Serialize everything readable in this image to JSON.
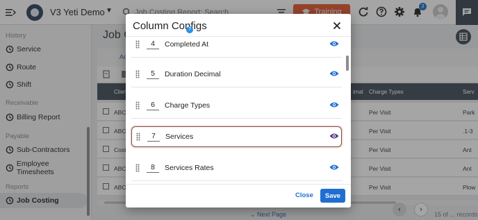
{
  "topbar": {
    "app_title": "V3 Yeti Demo",
    "search_placeholder": "Job Costing Report: Search",
    "training_label": "Training",
    "notification_count": "3"
  },
  "sidebar": {
    "sections": [
      {
        "title": "History",
        "items": [
          {
            "label": "Service"
          },
          {
            "label": "Route"
          },
          {
            "label": "Shift"
          }
        ]
      },
      {
        "title": "Receivable",
        "items": [
          {
            "label": "Billing Report"
          }
        ]
      },
      {
        "title": "Payable",
        "items": [
          {
            "label": "Sub-Contractors"
          },
          {
            "label": "Employee Timesheets"
          }
        ]
      },
      {
        "title": "Reports",
        "items": [
          {
            "label": "Job Costing",
            "active": true
          }
        ]
      }
    ]
  },
  "main": {
    "page_title": "Job C",
    "active_tab": "Ac",
    "table_headers": [
      "Client",
      "imal",
      "Charge Types",
      "Serv"
    ],
    "rows": [
      {
        "client": "ABC S",
        "charge": "Per Visit",
        "serv": "Park"
      },
      {
        "client": "ABC S",
        "charge": "Per Visit",
        "serv": ".1-3"
      },
      {
        "client": "Costc",
        "charge": "Per Visit",
        "serv": "Ant"
      },
      {
        "client": "ABC S",
        "charge": "Per Visit",
        "serv": "Ant"
      },
      {
        "client": "ABC S",
        "charge": "Per Visit",
        "serv": "Plow"
      }
    ],
    "next_page_label": "Next Page",
    "records_text": "15 of ... records"
  },
  "modal": {
    "title": "Column Configs",
    "help_badge": "?",
    "close_label": "Close",
    "save_label": "Save",
    "columns": [
      {
        "order": "4",
        "name": "Completed At",
        "visible": true
      },
      {
        "order": "5",
        "name": "Duration Decimal",
        "visible": true
      },
      {
        "order": "6",
        "name": "Charge Types",
        "visible": true
      },
      {
        "order": "7",
        "name": "Services",
        "visible": true,
        "selected": true
      },
      {
        "order": "8",
        "name": "Services Rates",
        "visible": true
      }
    ]
  },
  "colors": {
    "accent_blue": "#1f6fd1",
    "training_orange": "#e4572e",
    "table_header": "#414b57",
    "selected_border": "#7a4a3a"
  }
}
